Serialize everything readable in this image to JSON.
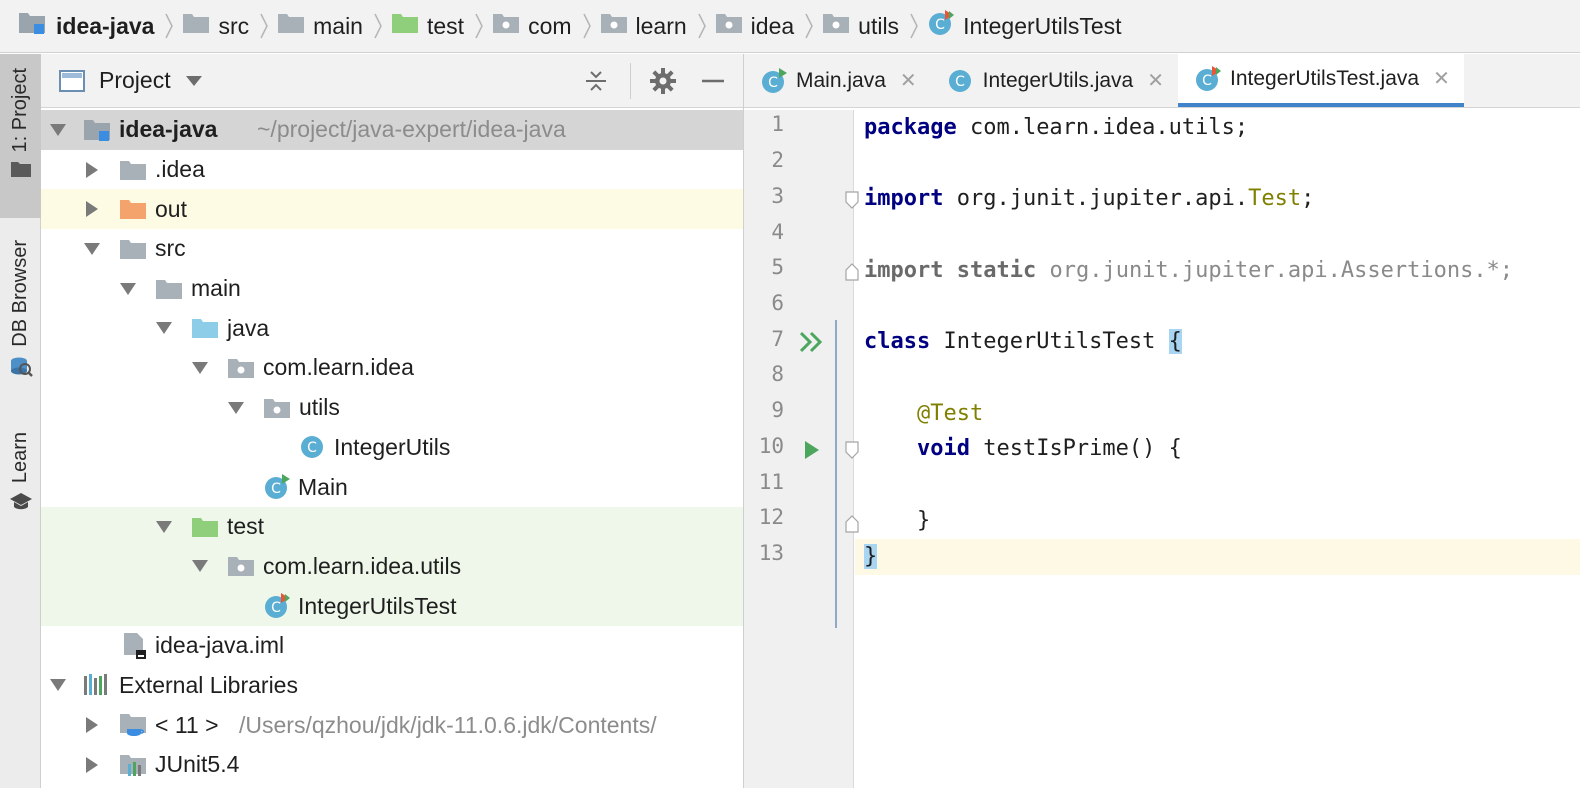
{
  "breadcrumb": [
    {
      "label": "idea-java",
      "icon": "module-folder-icon"
    },
    {
      "label": "src",
      "icon": "folder-icon"
    },
    {
      "label": "main",
      "icon": "folder-icon"
    },
    {
      "label": "test",
      "icon": "test-folder-icon"
    },
    {
      "label": "com",
      "icon": "package-icon"
    },
    {
      "label": "learn",
      "icon": "package-icon"
    },
    {
      "label": "idea",
      "icon": "package-icon"
    },
    {
      "label": "utils",
      "icon": "package-icon"
    },
    {
      "label": "IntegerUtilsTest",
      "icon": "test-class-icon"
    }
  ],
  "toolstrip": {
    "project_label": "1: Project",
    "db_label": "DB Browser",
    "learn_label": "Learn"
  },
  "project_panel": {
    "title": "Project",
    "tree": [
      {
        "label": "idea-java",
        "path": "~/project/java-expert/idea-java"
      },
      {
        "label": ".idea"
      },
      {
        "label": "out"
      },
      {
        "label": "src"
      },
      {
        "label": "main"
      },
      {
        "label": "java"
      },
      {
        "label": "com.learn.idea"
      },
      {
        "label": "utils"
      },
      {
        "label": "IntegerUtils"
      },
      {
        "label": "Main"
      },
      {
        "label": "test"
      },
      {
        "label": "com.learn.idea.utils"
      },
      {
        "label": "IntegerUtilsTest"
      },
      {
        "label": "idea-java.iml"
      },
      {
        "label": "External Libraries"
      },
      {
        "label": "< 11 >",
        "path": "/Users/qzhou/jdk/jdk-11.0.6.jdk/Contents/"
      },
      {
        "label": "JUnit5.4"
      }
    ]
  },
  "editor": {
    "tabs": [
      {
        "label": "Main.java",
        "active": false
      },
      {
        "label": "IntegerUtils.java",
        "active": false
      },
      {
        "label": "IntegerUtilsTest.java",
        "active": true
      }
    ],
    "line_numbers": [
      "1",
      "2",
      "3",
      "4",
      "5",
      "6",
      "7",
      "8",
      "9",
      "10",
      "11",
      "12",
      "13"
    ],
    "code": {
      "l1_kw": "package",
      "l1_rest": " com.learn.idea.utils;",
      "l3_kw": "import",
      "l3_rest": " org.junit.jupiter.api.",
      "l3_cls": "Test",
      "l3_end": ";",
      "l5_kw": "import",
      "l5_kw2": "static",
      "l5_rest": "org.junit.jupiter.api.Assertions.*;",
      "l7_kw": "class",
      "l7_rest": " IntegerUtilsTest ",
      "l7_brace": "{",
      "l9_ann": "@Test",
      "l10_kw": "void",
      "l10_rest": " testIsPrime() {",
      "l12_brace": "}",
      "l13_brace": "}"
    }
  },
  "colors": {
    "keyword": "#000080",
    "annotation": "#808000",
    "test_folder": "#8fcf7c",
    "excluded_folder": "#f5a36d",
    "source_folder": "#8ecde8",
    "class_icon": "#5aaed4",
    "run_icon": "#4ca65e",
    "accent": "#4083c9"
  }
}
